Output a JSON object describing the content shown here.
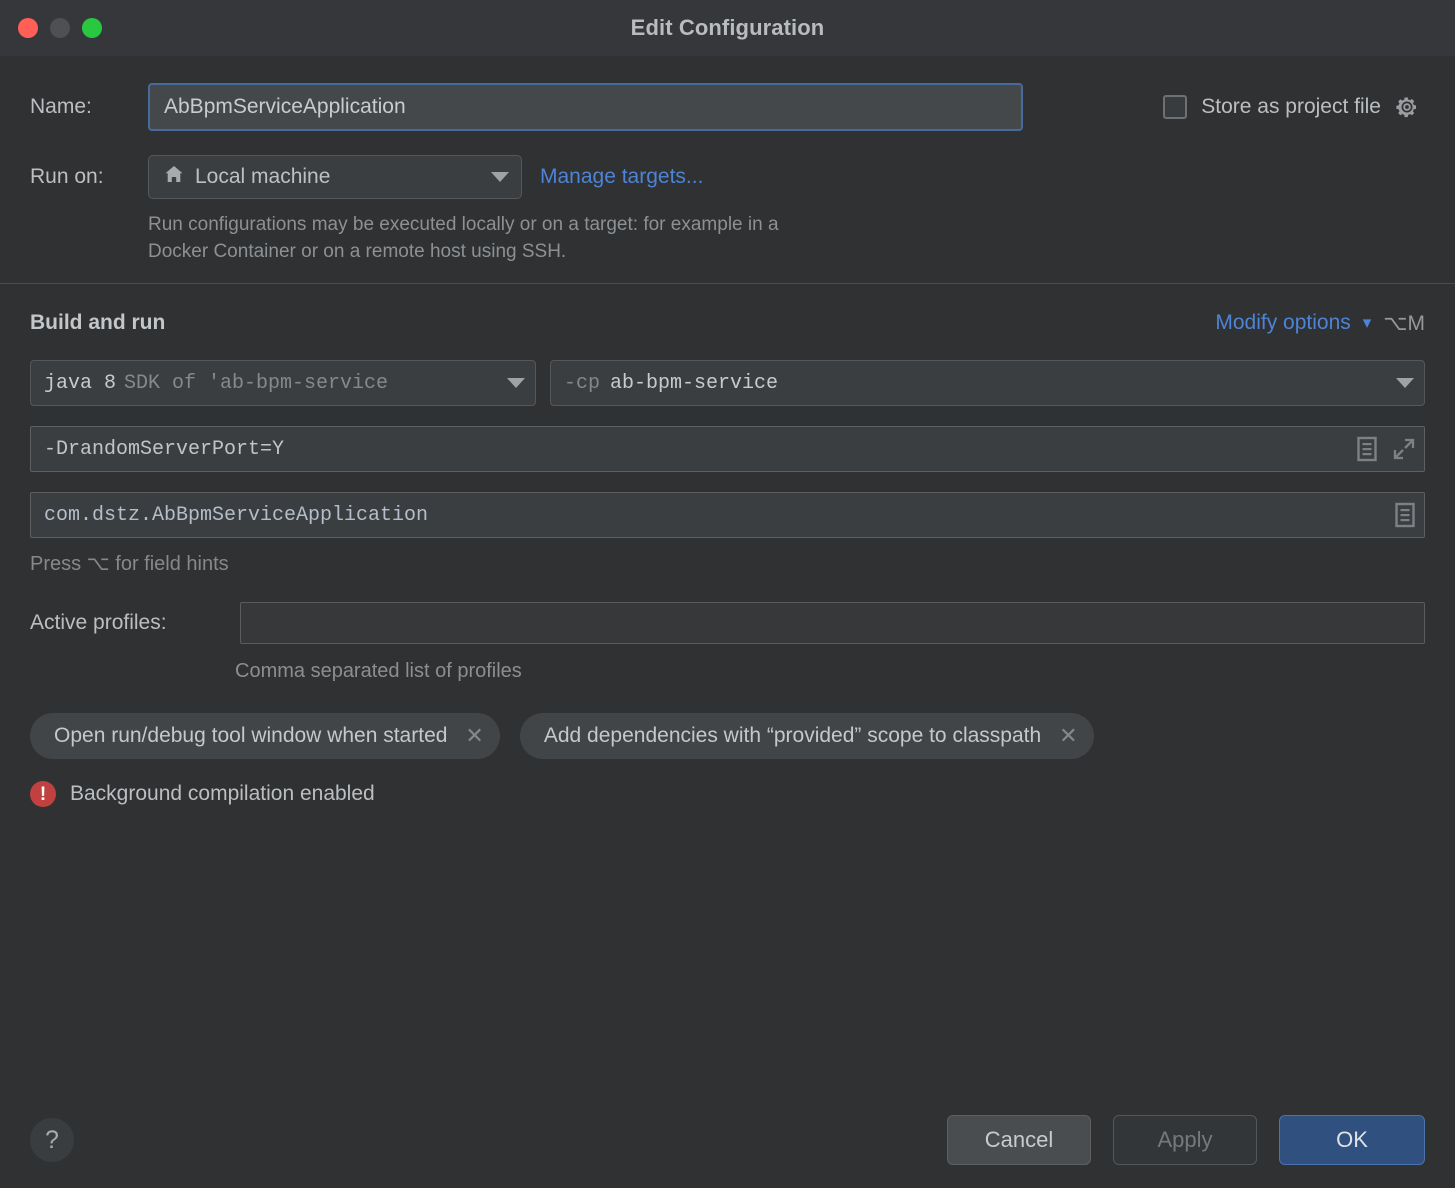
{
  "window": {
    "title": "Edit Configuration",
    "traffic_lights": [
      "close-button",
      "minimize-button",
      "maximize-button"
    ]
  },
  "colors": {
    "window_bg": "#2f3133",
    "titlebar_bg": "#35373a",
    "accent_link": "#4d84d6",
    "focus_border": "#466b9c",
    "ok_button_bg": "#305080",
    "warning_red": "#c0413f",
    "traffic_close": "#ff5f57",
    "traffic_min": "#4e5053",
    "traffic_max": "#28c840"
  },
  "name_row": {
    "label": "Name:",
    "value": "AbBpmServiceApplication",
    "placeholder": "",
    "store_as_project_file": {
      "label": "Store as project file",
      "checked": false,
      "gear_icon": "gear-icon"
    }
  },
  "run_on": {
    "label": "Run on:",
    "selected": "Local machine",
    "icon": "home-icon",
    "manage_targets_link": "Manage targets...",
    "description": "Run configurations may be executed locally or on a target: for example in a Docker Container or on a remote host using SSH."
  },
  "build_and_run": {
    "section_title": "Build and run",
    "modify_options_label": "Modify options",
    "modify_options_chevron": "chevron-down-icon",
    "modify_options_shortcut": "⌥M",
    "jdk": {
      "name": "java 8",
      "description": "SDK of 'ab-bpm-service"
    },
    "classpath": {
      "flag": "-cp",
      "module": "ab-bpm-service"
    },
    "vm_options": {
      "value": "-DrandomServerPort=Y",
      "icons": [
        "insert-macro-icon",
        "expand-icon"
      ]
    },
    "main_class": {
      "value": "com.dstz.AbBpmServiceApplication",
      "icons": [
        "insert-macro-icon"
      ]
    },
    "field_hint": "Press ⌥ for field hints"
  },
  "active_profiles": {
    "label": "Active profiles:",
    "value": "",
    "placeholder": "",
    "hint": "Comma separated list of profiles"
  },
  "option_chips": [
    {
      "label": "Open run/debug tool window when started",
      "remove_icon": "close-icon"
    },
    {
      "label": "Add dependencies with “provided” scope to classpath",
      "remove_icon": "close-icon"
    }
  ],
  "warning": {
    "icon": "error-icon",
    "text": "Background compilation enabled"
  },
  "footer": {
    "help_label": "?",
    "cancel_label": "Cancel",
    "apply_label": "Apply",
    "apply_enabled": false,
    "ok_label": "OK"
  }
}
